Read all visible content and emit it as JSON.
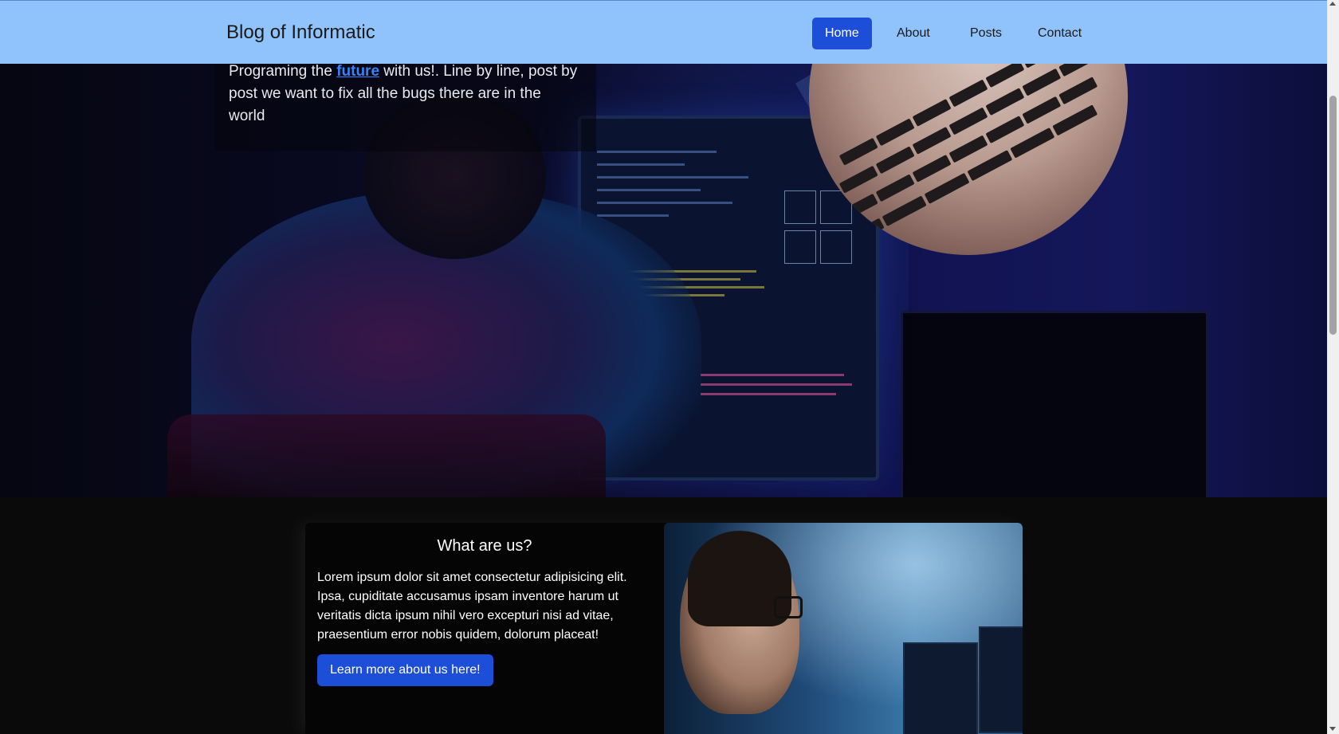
{
  "navbar": {
    "brand": "Blog of Informatic",
    "items": [
      {
        "label": "Home",
        "active": true
      },
      {
        "label": "About",
        "active": false
      },
      {
        "label": "Posts",
        "active": false
      },
      {
        "label": "Contact",
        "active": false
      }
    ]
  },
  "hero": {
    "text_before": "Programing the ",
    "link": "future",
    "text_after": " with us!. Line by line, post by post we want to fix all the bugs there are in the world"
  },
  "about_card": {
    "title": "What are us?",
    "body": "Lorem ipsum dolor sit amet consectetur adipisicing elit. Ipsa, cupiditate accusamus ipsam inventore harum ut veritatis dicta ipsum nihil vero excepturi nisi ad vitae, praesentium error nobis quidem, dolorum placeat!",
    "button": "Learn more about us here!"
  },
  "colors": {
    "navbar_bg": "#90c3fb",
    "accent": "#1d4ed8",
    "link": "#3b82f6",
    "page_bg": "#0a0a0b"
  }
}
